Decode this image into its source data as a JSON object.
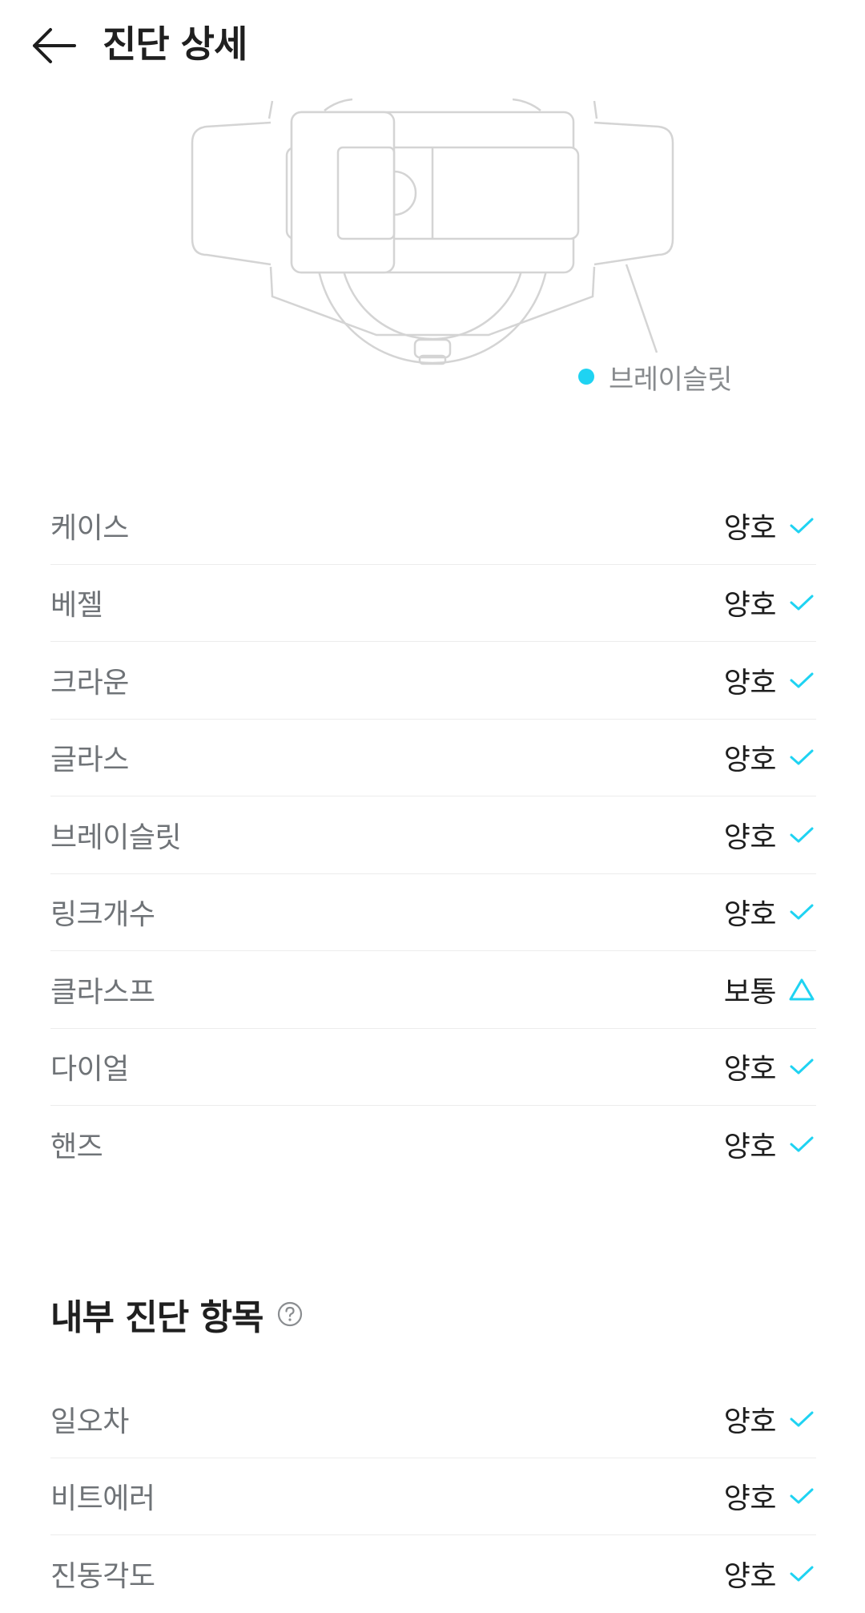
{
  "header": {
    "title": "진단 상세"
  },
  "diagram": {
    "highlight_label": "브레이슬릿",
    "highlight_color": "#1fd3f2"
  },
  "external_items": [
    {
      "label": "케이스",
      "status": "양호",
      "icon": "check-icon"
    },
    {
      "label": "베젤",
      "status": "양호",
      "icon": "check-icon"
    },
    {
      "label": "크라운",
      "status": "양호",
      "icon": "check-icon"
    },
    {
      "label": "글라스",
      "status": "양호",
      "icon": "check-icon"
    },
    {
      "label": "브레이슬릿",
      "status": "양호",
      "icon": "check-icon"
    },
    {
      "label": "링크개수",
      "status": "양호",
      "icon": "check-icon"
    },
    {
      "label": "클라스프",
      "status": "보통",
      "icon": "triangle-icon"
    },
    {
      "label": "다이얼",
      "status": "양호",
      "icon": "check-icon"
    },
    {
      "label": "핸즈",
      "status": "양호",
      "icon": "check-icon"
    }
  ],
  "internal_section": {
    "title": "내부 진단 항목",
    "help_icon": "question-circle-icon",
    "items": [
      {
        "label": "일오차",
        "status": "양호",
        "icon": "check-icon"
      },
      {
        "label": "비트에러",
        "status": "양호",
        "icon": "check-icon"
      },
      {
        "label": "진동각도",
        "status": "양호",
        "icon": "check-icon"
      }
    ]
  },
  "colors": {
    "accent": "#1fd3f2",
    "label_gray": "#6f7377",
    "divider": "#ececec"
  }
}
